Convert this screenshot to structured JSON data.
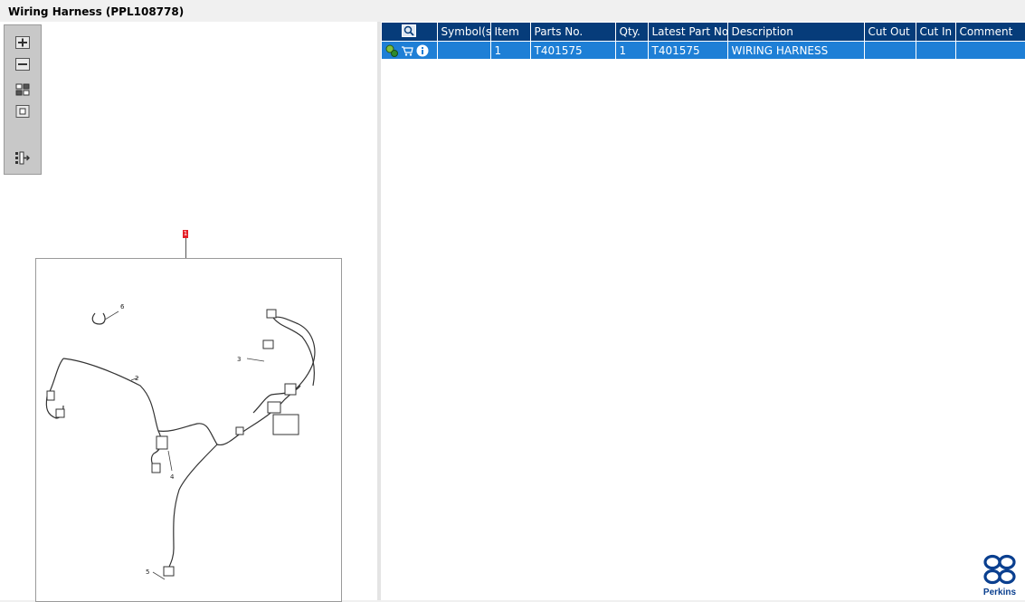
{
  "window": {
    "title": "Wiring Harness (PPL108778)"
  },
  "toolbar": {
    "buttons": [
      {
        "icon": "zoom-in-icon"
      },
      {
        "icon": "zoom-out-icon"
      },
      {
        "icon": "fit-window-icon"
      },
      {
        "icon": "actual-size-icon"
      },
      {
        "icon": "export-list-icon"
      }
    ]
  },
  "diagram": {
    "callout_tag": "1",
    "labels": [
      "2",
      "3",
      "4",
      "5",
      "6"
    ]
  },
  "table": {
    "columns": [
      "Symbol(s)",
      "Item",
      "Parts No.",
      "Qty.",
      "Latest Part No.",
      "Description",
      "Cut Out",
      "Cut In",
      "Comment"
    ],
    "rows": [
      {
        "symbols": "",
        "item": "1",
        "parts_no": "T401575",
        "qty": "1",
        "latest_part_no": "T401575",
        "description": "WIRING HARNESS",
        "cut_out": "",
        "cut_in": "",
        "comment": ""
      }
    ]
  },
  "logo": {
    "text": "Perkins"
  },
  "colors": {
    "header": "#063c7a",
    "row_selected": "#1e7fd6",
    "callout": "#e41e26",
    "brand": "#0a3f8f"
  }
}
